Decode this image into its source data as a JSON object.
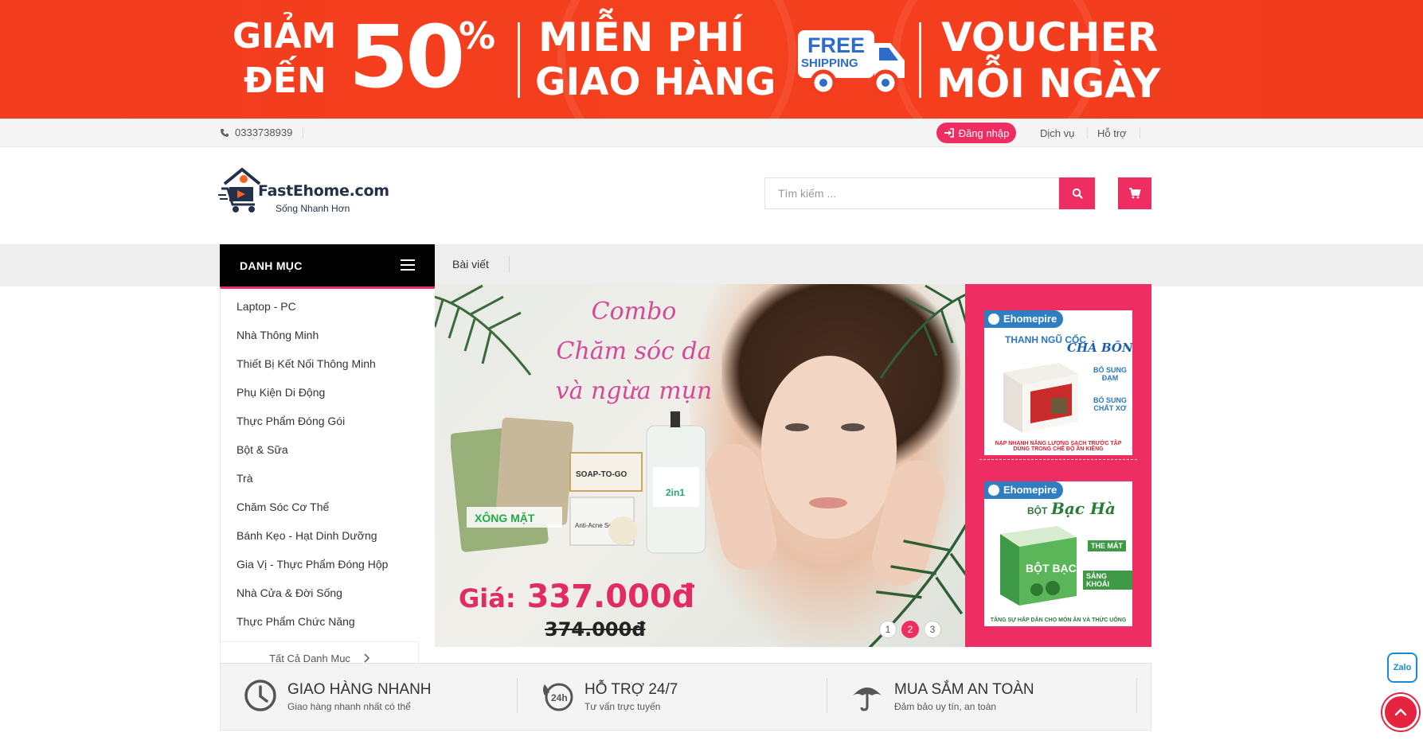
{
  "promo": {
    "discount_prefix_top": "GIẢM",
    "discount_prefix_bottom": "ĐẾN",
    "discount_value": "50",
    "discount_unit": "%",
    "shipping_top": "MIỄN PHÍ",
    "shipping_bottom": "GIAO HÀNG",
    "truck_line1": "FREE",
    "truck_line2": "SHIPPING",
    "voucher_top": "VOUCHER",
    "voucher_bottom": "MỖI NGÀY"
  },
  "topbar": {
    "phone": "0333738939",
    "login_label": "Đăng nhập",
    "links": [
      "Dịch vụ",
      "Hỗ trợ"
    ]
  },
  "header": {
    "brand": "FastEhome.com",
    "slogan": "Sống Nhanh Hơn",
    "search_placeholder": "Tìm kiếm ..."
  },
  "nav": {
    "category_heading": "DANH MỤC",
    "items": [
      "Bài viết"
    ]
  },
  "categories": {
    "items": [
      "Laptop - PC",
      "Nhà Thông Minh",
      "Thiết Bị Kết Nối Thông Minh",
      "Phụ Kiện Di Động",
      "Thực Phẩm Đóng Gói",
      "Bột & Sữa",
      "Trà",
      "Chăm Sóc Cơ Thể",
      "Bánh Kẹo - Hạt Dinh Dưỡng",
      "Gia Vị - Thực Phẩm Đóng Hộp",
      "Nhà Cửa & Đời Sống",
      "Thực Phẩm Chức Năng"
    ],
    "all_label": "Tất Cả Danh Mục"
  },
  "slider": {
    "title_line1": "Combo",
    "title_line2": "Chăm sóc da",
    "title_line3": "và ngừa mụn",
    "product_label_1": "XÔNG MẶT",
    "product_label_2": "SOAP-TO-GO",
    "product_label_3": "Anti-Acne Soap",
    "product_label_4": "2in1",
    "price_prefix": "Giá:",
    "price": "337.000đ",
    "old_price": "374.000đ",
    "pages": [
      "1",
      "2",
      "3"
    ],
    "active_page": 2
  },
  "side_ads": [
    {
      "brand": "Ehomepire",
      "title": "THANH NGŨ CỐC",
      "title_accent": "CHÀ BÔNG",
      "tag1": "BỔ SUNG ĐẠM",
      "tag2": "BỔ SUNG CHẤT XƠ",
      "footer": "NẠP NHANH NĂNG LƯỢNG SẠCH TRƯỚC TẬP DÙNG TRONG CHẾ ĐỘ ĂN KIÊNG"
    },
    {
      "brand": "Ehomepire",
      "title": "BỘT",
      "title_accent": "Bạc Hà",
      "tag1": "THE MÁT",
      "tag2": "SẢNG KHOÁI",
      "footer": "TĂNG SỰ HẤP DẪN CHO MÓN ĂN VÀ THỨC UỐNG"
    }
  ],
  "features": [
    {
      "title": "GIAO HÀNG NHANH",
      "subtitle": "Giao hàng nhanh nhất có thể",
      "icon": "clock-icon"
    },
    {
      "title": "HỖ TRỢ 24/7",
      "subtitle": "Tư vấn trực tuyến",
      "icon": "support-24h-icon"
    },
    {
      "title": "MUA SẮM AN TOÀN",
      "subtitle": "Đảm bảo uy tín, an toàn",
      "icon": "umbrella-icon"
    }
  ],
  "floating": {
    "zalo_label": "Zalo"
  },
  "colors": {
    "accent": "#ee2d63",
    "promo_bg": "#f23c1f",
    "category_header_bg": "#000000"
  }
}
